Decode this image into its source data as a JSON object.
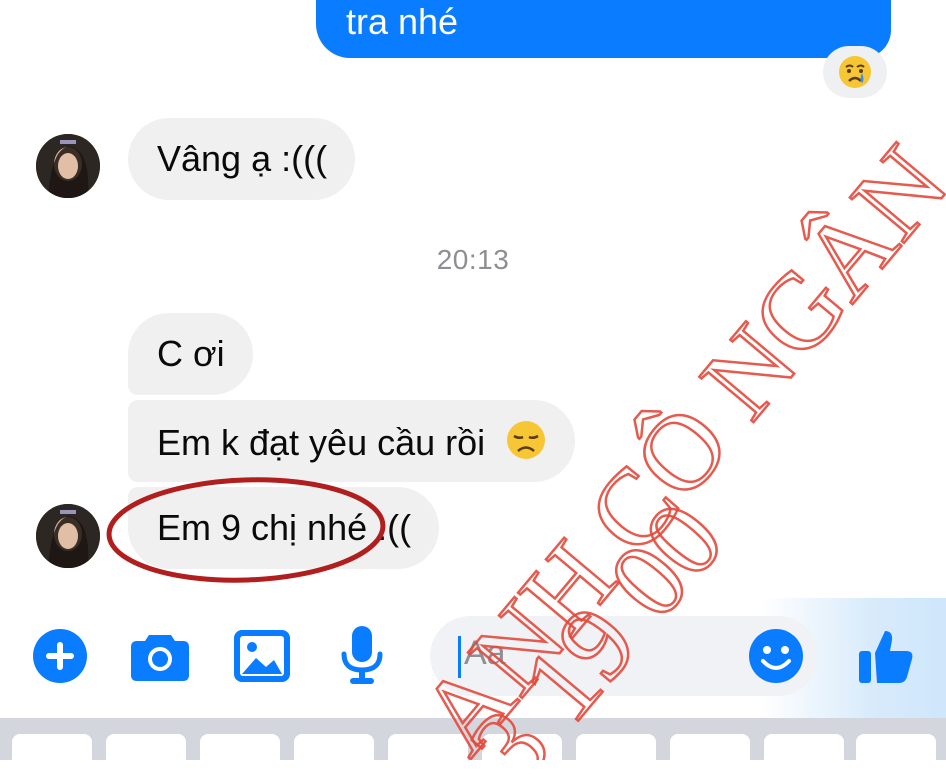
{
  "conversation": {
    "outgoing": [
      {
        "text": "tra nhé",
        "reaction": "crying-face-emoji"
      }
    ],
    "incoming_before": [
      {
        "text": "Vâng ạ :((("
      }
    ],
    "timestamp": "20:13",
    "incoming_after": [
      {
        "text": "C ơi"
      },
      {
        "text": "Em k đạt yêu cầu rồi",
        "emoji": "disappointed-face-emoji"
      },
      {
        "text": "Em 9 chị nhé :(("
      }
    ]
  },
  "composer": {
    "placeholder": "Aa",
    "icons": [
      "plus-icon",
      "camera-icon",
      "image-icon",
      "microphone-icon",
      "emoji-icon",
      "like-icon"
    ]
  },
  "watermark": {
    "line1": "ANH CÔ NGÂN",
    "line2": "3 19 00"
  },
  "colors": {
    "messenger_blue": "#0a7cff",
    "incoming_bubble": "#f0f0f0",
    "highlight_circle": "#b01e1e",
    "watermark_red": "#e34a3c"
  }
}
